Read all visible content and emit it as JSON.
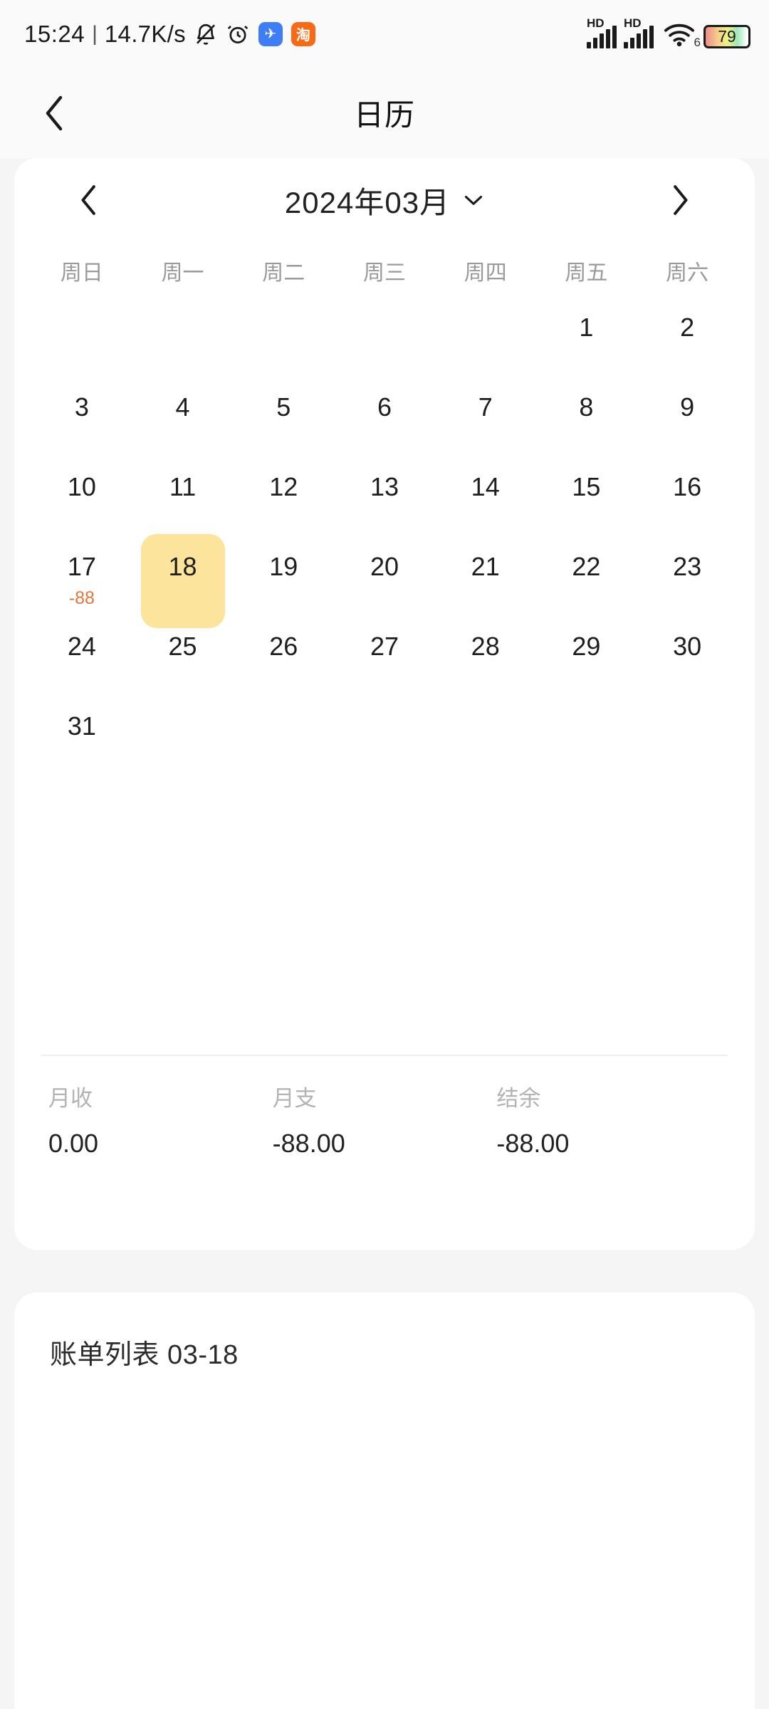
{
  "status_bar": {
    "time": "15:24",
    "separator": "|",
    "network_speed": "14.7K/s",
    "icons": [
      "bell-muted-icon",
      "alarm-clock-icon"
    ],
    "app_badges": [
      {
        "name": "messenger-app-icon",
        "glyph": "✈",
        "color": "#3d7ef7"
      },
      {
        "name": "taobao-app-icon",
        "glyph": "淘",
        "color": "#f96a15"
      }
    ],
    "signal_1_label": "HD",
    "signal_2_label": "HD",
    "wifi_generation": "6",
    "battery_level": "79"
  },
  "app_bar": {
    "back_icon": "chevron-left-icon",
    "title": "日历"
  },
  "calendar": {
    "prev_icon": "chevron-left-icon",
    "next_icon": "chevron-right-icon",
    "dropdown_icon": "chevron-down-icon",
    "month_title": "2024年03月",
    "weekdays": [
      "周日",
      "周一",
      "周二",
      "周三",
      "周四",
      "周五",
      "周六"
    ],
    "leading_blanks": 5,
    "days": [
      {
        "num": "1"
      },
      {
        "num": "2"
      },
      {
        "num": "3"
      },
      {
        "num": "4"
      },
      {
        "num": "5"
      },
      {
        "num": "6"
      },
      {
        "num": "7"
      },
      {
        "num": "8"
      },
      {
        "num": "9"
      },
      {
        "num": "10"
      },
      {
        "num": "11"
      },
      {
        "num": "12"
      },
      {
        "num": "13"
      },
      {
        "num": "14"
      },
      {
        "num": "15"
      },
      {
        "num": "16"
      },
      {
        "num": "17",
        "amount": "-88"
      },
      {
        "num": "18",
        "selected": true
      },
      {
        "num": "19"
      },
      {
        "num": "20"
      },
      {
        "num": "21"
      },
      {
        "num": "22"
      },
      {
        "num": "23"
      },
      {
        "num": "24"
      },
      {
        "num": "25"
      },
      {
        "num": "26"
      },
      {
        "num": "27"
      },
      {
        "num": "28"
      },
      {
        "num": "29"
      },
      {
        "num": "30"
      },
      {
        "num": "31"
      }
    ],
    "selected_day": "18",
    "highlight_color": "#fce49c",
    "expense_color": "#e8763a"
  },
  "summary": {
    "income_label": "月收",
    "income_value": "0.00",
    "expense_label": "月支",
    "expense_value": "-88.00",
    "balance_label": "结余",
    "balance_value": "-88.00"
  },
  "bill_list": {
    "title": "账单列表 03-18",
    "items": []
  }
}
